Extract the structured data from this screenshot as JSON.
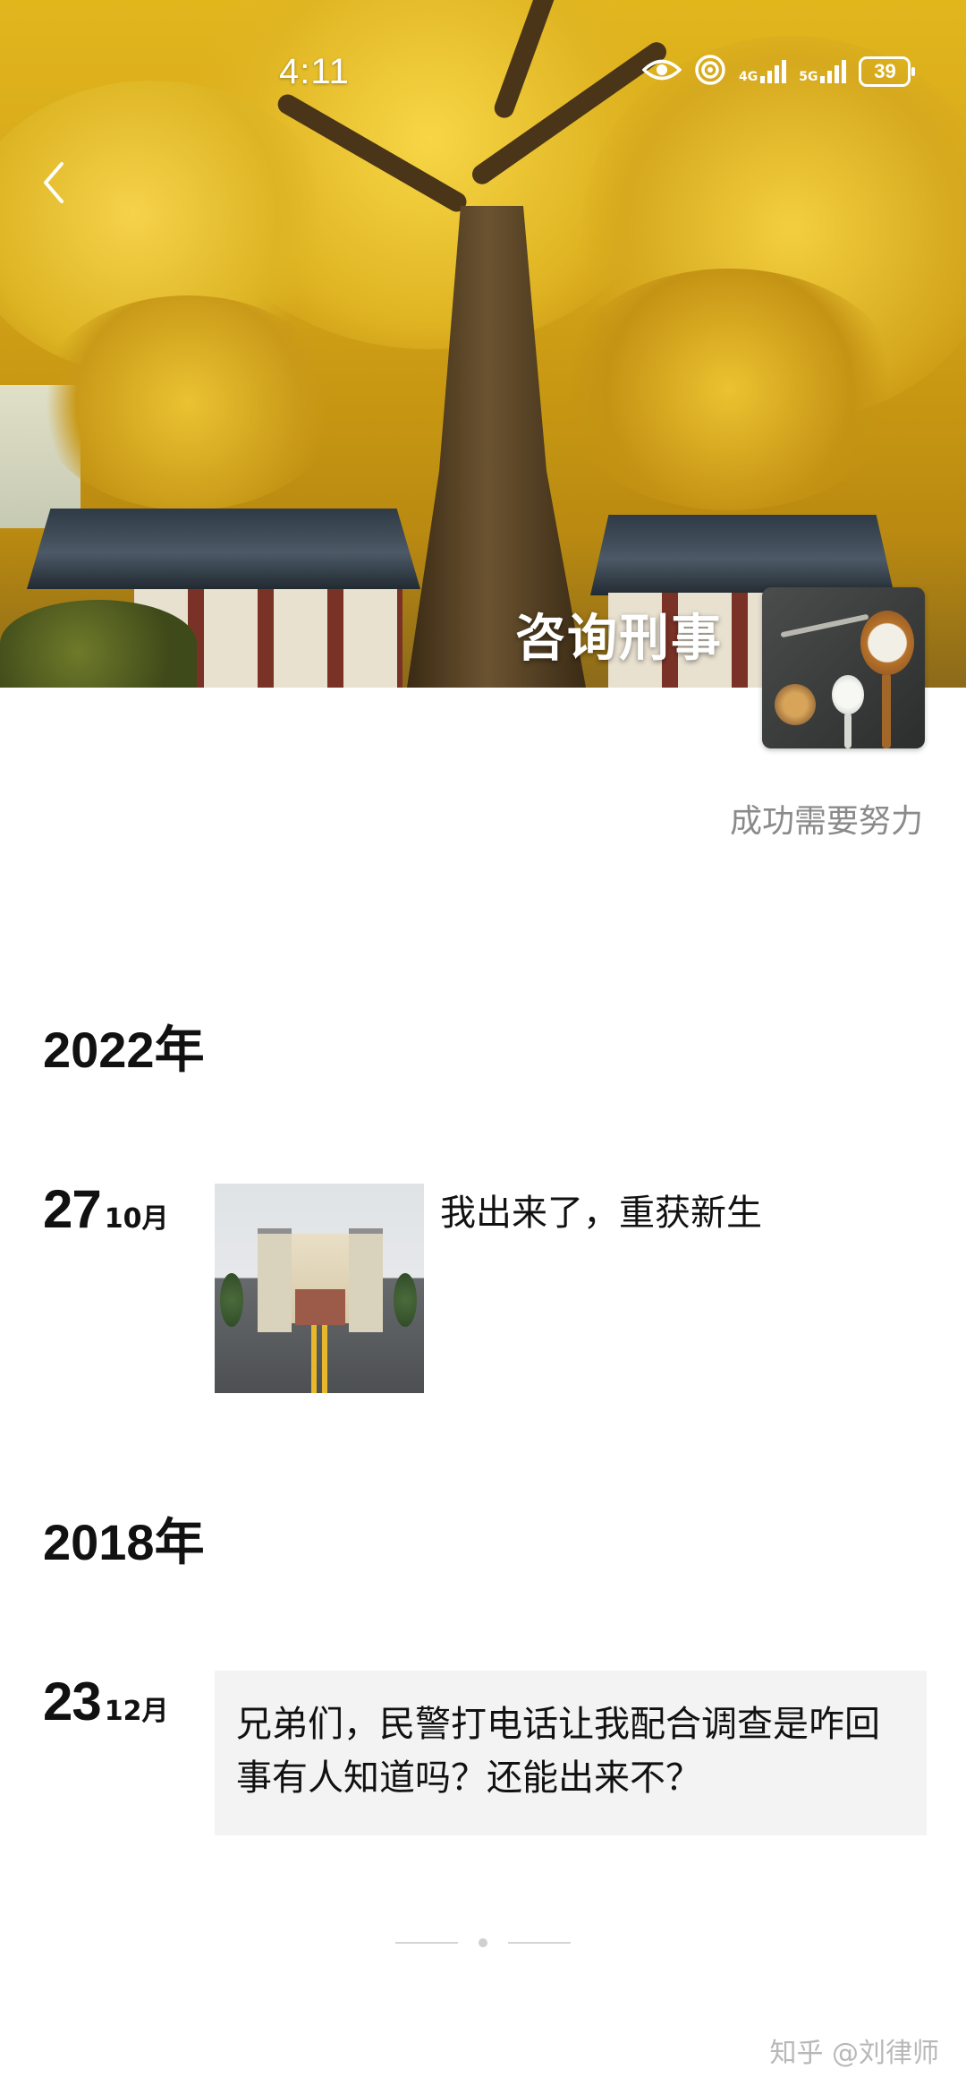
{
  "status_bar": {
    "time": "4:11",
    "net1": "4G",
    "net2": "5G",
    "battery": "39",
    "icons": [
      "eye-icon",
      "hotspot-icon",
      "signal-4g-icon",
      "signal-5g-icon",
      "battery-icon"
    ]
  },
  "header": {
    "back_icon": "chevron-left-icon",
    "title": "咨询刑事",
    "signature": "成功需要努力"
  },
  "timeline": [
    {
      "year": "2022年",
      "posts": [
        {
          "day": "27",
          "month": "10月",
          "text": "我出来了，重获新生",
          "has_image": true
        }
      ]
    },
    {
      "year": "2018年",
      "posts": [
        {
          "day": "23",
          "month": "12月",
          "text": "兄弟们，民警打电话让我配合调查是咋回事有人知道吗？还能出来不？",
          "has_image": false
        }
      ]
    }
  ],
  "watermark": "知乎 @刘律师",
  "colors": {
    "cover_yellow": "#e1b61d",
    "card_bg": "#f3f3f3",
    "signature_gray": "#8a8a8a"
  }
}
